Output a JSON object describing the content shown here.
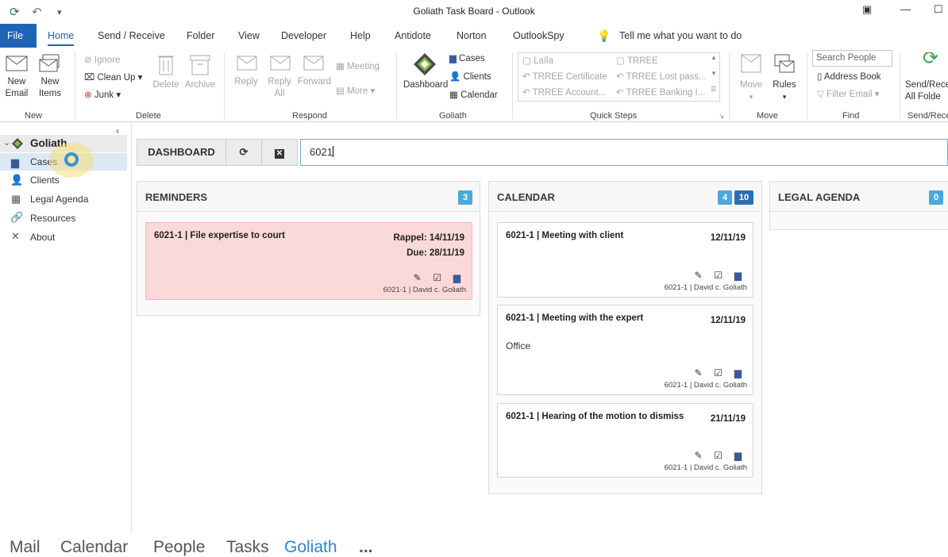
{
  "window": {
    "title": "Goliath Task Board  -  Outlook"
  },
  "menu": {
    "file": "File",
    "tabs": [
      "Home",
      "Send / Receive",
      "Folder",
      "View",
      "Developer",
      "Help",
      "Antidote",
      "Norton",
      "OutlookSpy"
    ],
    "tell_me": "Tell me what you want to do"
  },
  "ribbon": {
    "new": {
      "label": "New",
      "new_email": "New\nEmail",
      "new_items": "New\nItems"
    },
    "delete": {
      "label": "Delete",
      "ignore": "Ignore",
      "clean_up": "Clean Up",
      "junk": "Junk",
      "delete": "Delete",
      "archive": "Archive"
    },
    "respond": {
      "label": "Respond",
      "reply": "Reply",
      "reply_all": "Reply\nAll",
      "forward": "Forward",
      "meeting": "Meeting",
      "more": "More"
    },
    "goliath": {
      "label": "Goliath",
      "dashboard": "Dashboard",
      "cases": "Cases",
      "clients": "Clients",
      "calendar": "Calendar"
    },
    "quick_steps": {
      "label": "Quick Steps",
      "items": [
        "Laïla",
        "TRREE",
        "TRREE Certificate",
        "TRREE Lost pass...",
        "TRREE Account...",
        "TRREE Banking I..."
      ]
    },
    "move": {
      "label": "Move",
      "move": "Move",
      "rules": "Rules"
    },
    "find": {
      "label": "Find",
      "search_people": "Search People",
      "address_book": "Address Book",
      "filter_email": "Filter Email"
    },
    "send_receive": {
      "label": "Send/Rece",
      "send_receive_all": "Send/Rece\nAll Folde"
    }
  },
  "nav": {
    "root": "Goliath",
    "items": [
      "Cases",
      "Clients",
      "Legal Agenda",
      "Resources",
      "About"
    ]
  },
  "dashboard": {
    "dashboard_button": "DASHBOARD",
    "search_value": "6021"
  },
  "reminders": {
    "title": "REMINDERS",
    "count": "3",
    "cards": [
      {
        "title": "6021-1 | File expertise to court",
        "rappel": "Rappel: 14/11/19",
        "due": "Due: 28/11/19",
        "footer": "6021-1 | David c. Goliath"
      }
    ]
  },
  "calendar": {
    "title": "CALENDAR",
    "count_a": "4",
    "count_b": "10",
    "cards": [
      {
        "title": "6021-1 | Meeting with client",
        "date": "12/11/19",
        "body": "",
        "footer": "6021-1 | David c. Goliath"
      },
      {
        "title": "6021-1 | Meeting with the expert",
        "date": "12/11/19",
        "body": "Office",
        "footer": "6021-1 | David c. Goliath"
      },
      {
        "title": "6021-1 | Hearing of the motion to dismiss",
        "date": "21/11/19",
        "body": "",
        "footer": "6021-1 | David c. Goliath"
      }
    ]
  },
  "legal_agenda": {
    "title": "LEGAL AGENDA",
    "count": "0"
  },
  "bottom_nav": [
    "Mail",
    "Calendar",
    "People",
    "Tasks",
    "Goliath",
    "..."
  ],
  "colors": {
    "accent": "#1e64b4",
    "badge_light": "#4aa8dc",
    "badge_dark": "#2a6fb3",
    "reminder_bg": "#fbd9d8"
  }
}
